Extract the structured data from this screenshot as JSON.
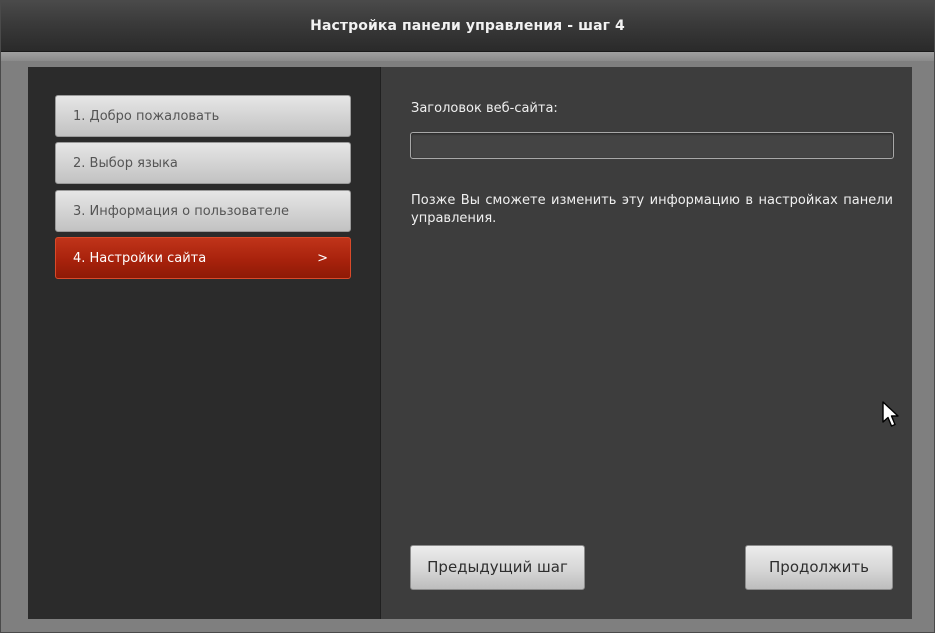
{
  "window": {
    "title": "Настройка панели управления - шаг 4"
  },
  "sidebar": {
    "steps": [
      {
        "label": "1. Добро пожаловать",
        "active": false
      },
      {
        "label": "2. Выбор языка",
        "active": false
      },
      {
        "label": "3. Информация о пользователе",
        "active": false
      },
      {
        "label": "4. Настройки сайта",
        "active": true
      }
    ],
    "active_indicator": ">"
  },
  "main": {
    "site_title_label": "Заголовок веб-сайта:",
    "site_title_value": "",
    "info_text": "Позже Вы сможете изменить эту информацию в настройках панели управления."
  },
  "buttons": {
    "prev_label": "Предыдущий шаг",
    "next_label": "Продолжить"
  },
  "colors": {
    "accent": "#a8220c",
    "sidebar_bg": "#2b2b2b",
    "content_bg": "#3d3d3d"
  },
  "icons": {
    "cursor": "mouse-pointer-icon"
  }
}
